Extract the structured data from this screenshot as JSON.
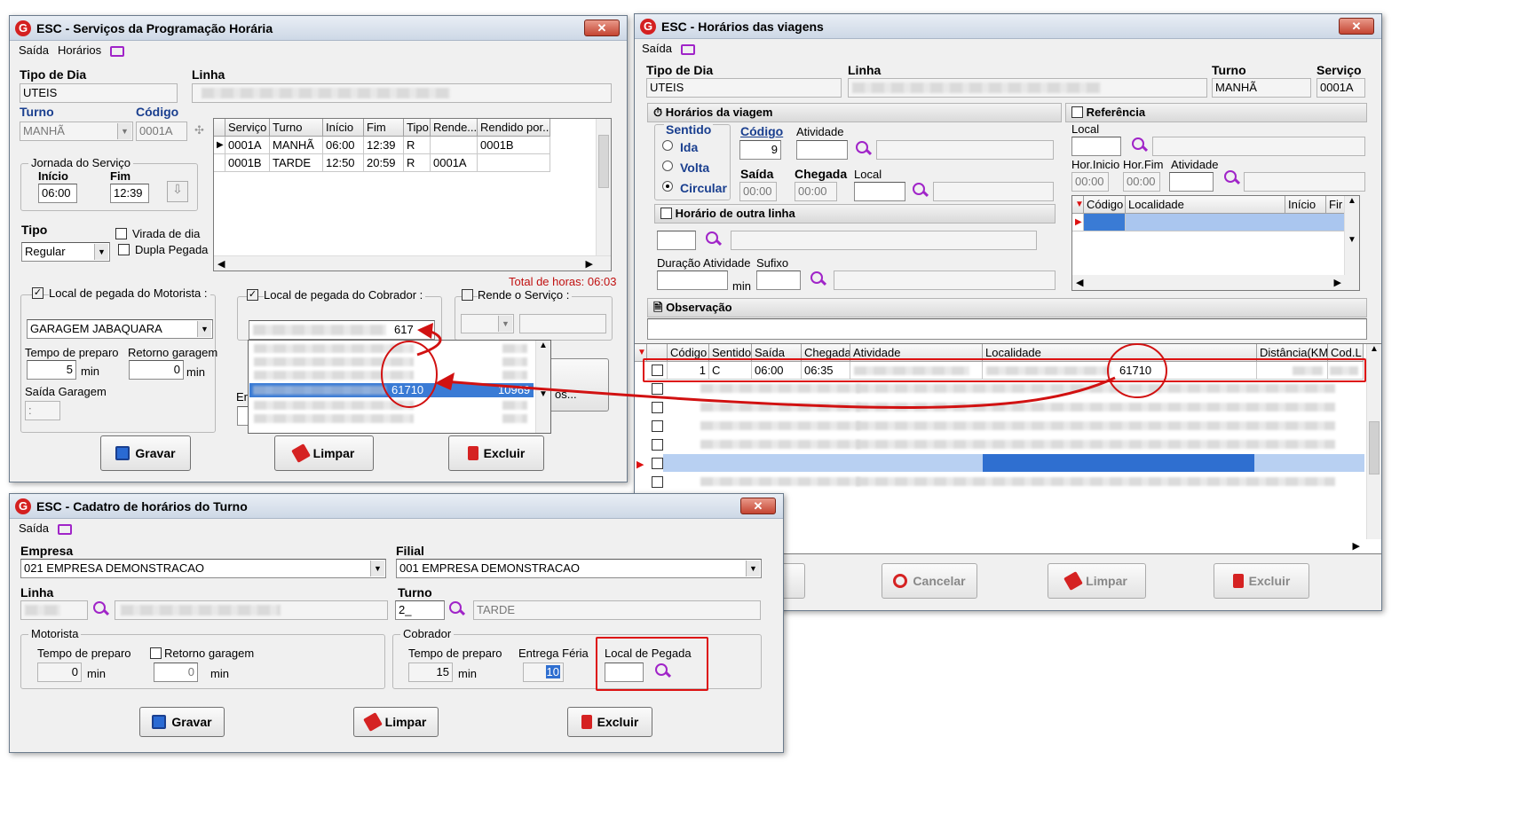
{
  "win1": {
    "title": "ESC - Serviços da Programação Horária",
    "menu": [
      "Saída",
      "Horários"
    ],
    "tipo_dia_label": "Tipo de Dia",
    "tipo_dia": "UTEIS",
    "linha_label": "Linha",
    "turno_label": "Turno",
    "turno": "MANHÃ",
    "codigo_label": "Código",
    "codigo": "0001A",
    "jornada_label": "Jornada do Serviço",
    "inicio_label": "Início",
    "inicio": "06:00",
    "fim_label": "Fim",
    "fim": "12:39",
    "tipo_label": "Tipo",
    "tipo": "Regular",
    "virada": "Virada de dia",
    "dupla": "Dupla Pegada",
    "grid_headers": [
      "Serviço",
      "Turno",
      "Início",
      "Fim",
      "Tipo",
      "Rende...",
      "Rendido por..."
    ],
    "rows": [
      [
        "0001A",
        "MANHÃ",
        "06:00",
        "12:39",
        "R",
        "",
        "0001B"
      ],
      [
        "0001B",
        "TARDE",
        "12:50",
        "20:59",
        "R",
        "0001A",
        ""
      ]
    ],
    "total_horas": "Total de horas: 06:03",
    "motorista_label": "Local de pegada do Motorista :",
    "motorista_local": "GARAGEM JABAQUARA",
    "tempo_preparo_label": "Tempo de preparo",
    "tempo_preparo": "5",
    "min": "min",
    "retorno_label": "Retorno garagem",
    "retorno": "0",
    "saida_garagem_label": "Saída Garagem",
    "saida_garagem": ":",
    "cobrador_label": "Local de pegada do Cobrador :",
    "cobrador_code": "617",
    "rende_label": "Rende o Serviço :",
    "dropdown_sel_code": "61710",
    "dropdown_sel_num": "10969",
    "partial_letter": "Er",
    "partial_btn": "os...",
    "gravar": "Gravar",
    "limpar": "Limpar",
    "excluir": "Excluir"
  },
  "win2": {
    "title": "ESC - Horários das viagens",
    "menu": [
      "Saída"
    ],
    "tipo_dia_label": "Tipo de Dia",
    "tipo_dia": "UTEIS",
    "linha_label": "Linha",
    "turno_label": "Turno",
    "turno": "MANHÃ",
    "servico_label": "Serviço",
    "servico": "0001A",
    "horarios_label": "Horários da viagem",
    "sentido_label": "Sentido",
    "ida": "Ida",
    "volta": "Volta",
    "circular": "Circular",
    "codigo_label": "Código",
    "codigo": "9",
    "atividade_label": "Atividade",
    "saida_label": "Saída",
    "saida": "00:00",
    "chegada_label": "Chegada",
    "chegada": "00:00",
    "local_label": "Local",
    "outra_linha": "Horário de outra linha",
    "duracao_label": "Duração Atividade",
    "sufixo_label": "Sufixo",
    "min": "min",
    "referencia": "Referência",
    "ref_local": "Local",
    "hor_inicio": "Hor.Inicio",
    "hor_fim": "Hor.Fim",
    "ref_atividade": "Atividade",
    "ref_hi": "00:00",
    "ref_hf": "00:00",
    "ref_headers": [
      "Código",
      "Localidade",
      "Início",
      "Fir"
    ],
    "observacao": "Observação",
    "grid_headers": [
      "Código",
      "Sentido",
      "Saída",
      "Chegada",
      "Atividade",
      "Localidade",
      "Distância(KM)",
      "Cod.L"
    ],
    "row1": {
      "codigo": "1",
      "sentido": "C",
      "saida": "06:00",
      "chegada": "06:35",
      "loc_code": "61710"
    },
    "cancelar": "Cancelar",
    "limpar": "Limpar",
    "excluir": "Excluir",
    "partial_btn": "r"
  },
  "win3": {
    "title": "ESC - Cadatro de horários do Turno",
    "menu": [
      "Saída"
    ],
    "empresa_label": "Empresa",
    "empresa": "021 EMPRESA DEMONSTRACAO",
    "filial_label": "Filial",
    "filial": "001 EMPRESA DEMONSTRACAO",
    "linha_label": "Linha",
    "turno_label": "Turno",
    "turno_code": "2_",
    "turno_name": "TARDE",
    "motorista": "Motorista",
    "tempo_preparo": "Tempo de preparo",
    "mot_preparo": "0",
    "retorno": "Retorno garagem",
    "mot_retorno": "0",
    "min": "min",
    "cobrador": "Cobrador",
    "cob_preparo": "15",
    "entrega_label": "Entrega Féria",
    "entrega": "10",
    "local_pegada": "Local de Pegada",
    "gravar": "Gravar",
    "limpar": "Limpar",
    "excluir": "Excluir"
  },
  "accent": "#d11111"
}
